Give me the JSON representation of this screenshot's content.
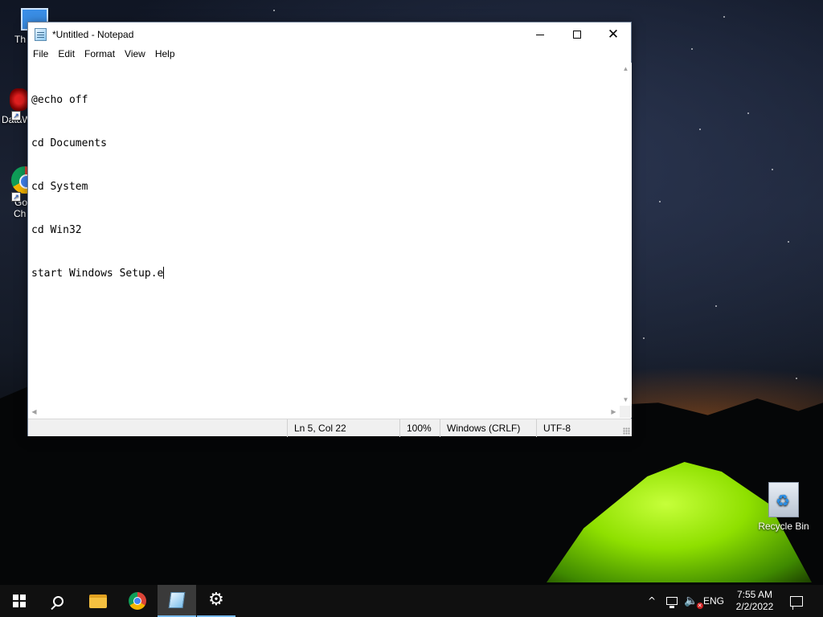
{
  "desktop": {
    "icons": [
      {
        "label": "Th",
        "icon": "this-pc-icon"
      },
      {
        "label": "DataW",
        "icon": "datawarehouse-icon"
      },
      {
        "label_line1": "Go",
        "label_line2": "Ch",
        "icon": "google-chrome-icon"
      },
      {
        "label": "Recycle Bin",
        "icon": "recycle-bin-icon"
      }
    ]
  },
  "notepad": {
    "title": "*Untitled - Notepad",
    "menu": [
      "File",
      "Edit",
      "Format",
      "View",
      "Help"
    ],
    "lines": [
      "@echo off",
      "cd Documents",
      "cd System",
      "cd Win32",
      "start Windows Setup.e"
    ],
    "status": {
      "position": "Ln 5, Col 22",
      "zoom": "100%",
      "line_ending": "Windows (CRLF)",
      "encoding": "UTF-8"
    }
  },
  "taskbar": {
    "apps": [
      "start-icon",
      "search-icon",
      "file-explorer-icon",
      "chrome-icon",
      "notepad-icon",
      "settings-icon"
    ],
    "tray": {
      "language": "ENG",
      "time": "7:55 AM",
      "date": "2/2/2022"
    }
  },
  "colors": {
    "taskbar_bg": "#101010",
    "active_indicator": "#76b9ed",
    "tent_green": "#8fe000"
  }
}
